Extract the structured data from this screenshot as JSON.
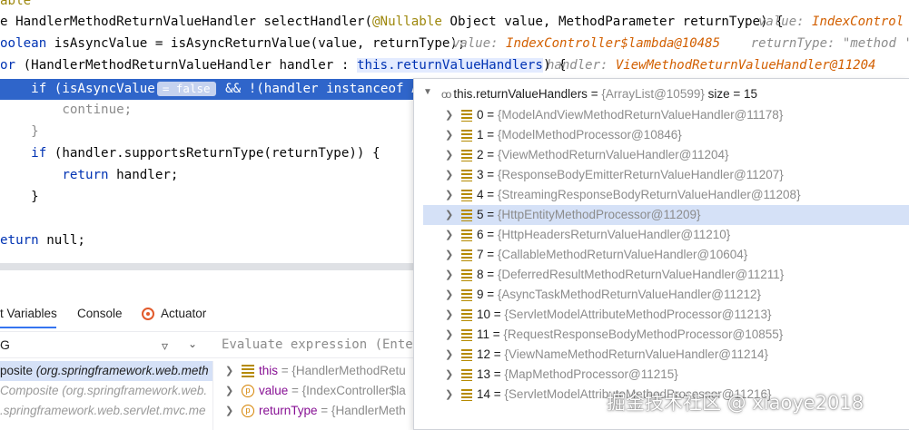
{
  "editor": {
    "line0": "able",
    "line1": {
      "kw": "",
      "a": "e HandlerMethodReturnValueHandler selectHandler(",
      "ann": "@Nullable",
      "b": " Object value, MethodParameter returnType) {"
    },
    "line1_hint": {
      "label": "value: ",
      "value": "IndexControl"
    },
    "line2": {
      "kw": "oolean",
      "rest": " isAsyncValue = isAsyncReturnValue(value, returnType);"
    },
    "line2_hint": {
      "label1": "value: ",
      "value1": "IndexController$lambda@10485",
      "label2": "    returnType: ",
      "value2": "\"method 'i"
    },
    "line3": {
      "kw": "or",
      "a": " (HandlerMethodReturnValueHandler handler : ",
      "this": "this",
      "dot": ".",
      "field": "returnValueHandlers",
      "b": ") {"
    },
    "line3_hint": {
      "label": "handler: ",
      "value": "ViewMethodReturnValueHandler@11204"
    },
    "line4": {
      "a": "    if (isAsyncValue",
      "pill": "= false",
      "b": " && !(handler instanceof AsyncH"
    },
    "line5": "        continue;",
    "line6": "    }",
    "line7": {
      "kw": "    if",
      "rest": " (handler.supportsReturnType(returnType)) {"
    },
    "line8": {
      "kw": "        return",
      "rest": " handler;"
    },
    "line9": "    }",
    "line10": {
      "kw": "eturn",
      "rest": " null;"
    }
  },
  "debug_tabs": {
    "variables": "t Variables",
    "console": "Console",
    "actuator": "Actuator"
  },
  "toolbar": {
    "left_text": "G",
    "filter_icon": "filter-icon",
    "eval_placeholder": "Evaluate expression (Enter"
  },
  "frames": [
    {
      "a": "posite ",
      "b": "(org.springframework.web.meth"
    },
    {
      "a": "Composite ",
      "b": "(org.springframework.web."
    },
    {
      "a": ".springframework.web.servlet.mvc.me",
      "b": ""
    }
  ],
  "variables": [
    {
      "name": "this",
      "value": " = {HandlerMethodRetu"
    },
    {
      "name": "value",
      "value": " = {IndexController$la"
    },
    {
      "name": "returnType",
      "value": " = {HandlerMeth"
    }
  ],
  "popup": {
    "header_name": "this.returnValueHandlers",
    "header_eq": " = ",
    "header_type": "{ArrayList@10599}",
    "header_size": "  size = 15",
    "selected_index": 5,
    "items": [
      {
        "i": "0",
        "v": "{ModelAndViewMethodReturnValueHandler@11178}"
      },
      {
        "i": "1",
        "v": "{ModelMethodProcessor@10846}"
      },
      {
        "i": "2",
        "v": "{ViewMethodReturnValueHandler@11204}"
      },
      {
        "i": "3",
        "v": "{ResponseBodyEmitterReturnValueHandler@11207}"
      },
      {
        "i": "4",
        "v": "{StreamingResponseBodyReturnValueHandler@11208}"
      },
      {
        "i": "5",
        "v": "{HttpEntityMethodProcessor@11209}"
      },
      {
        "i": "6",
        "v": "{HttpHeadersReturnValueHandler@11210}"
      },
      {
        "i": "7",
        "v": "{CallableMethodReturnValueHandler@10604}"
      },
      {
        "i": "8",
        "v": "{DeferredResultMethodReturnValueHandler@11211}"
      },
      {
        "i": "9",
        "v": "{AsyncTaskMethodReturnValueHandler@11212}"
      },
      {
        "i": "10",
        "v": "{ServletModelAttributeMethodProcessor@11213}"
      },
      {
        "i": "11",
        "v": "{RequestResponseBodyMethodProcessor@10855}"
      },
      {
        "i": "12",
        "v": "{ViewNameMethodReturnValueHandler@11214}"
      },
      {
        "i": "13",
        "v": "{MapMethodProcessor@11215}"
      },
      {
        "i": "14",
        "v": "{ServletModelAttributeMethodProcessor@11216}"
      }
    ]
  },
  "watermark": "掘金技术社区 @ xiaoye2018"
}
